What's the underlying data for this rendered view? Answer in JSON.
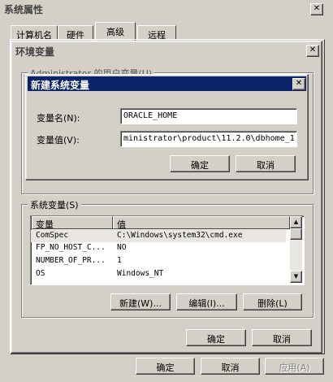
{
  "sysprops": {
    "title": "系统属性",
    "close": "✕",
    "tabs": [
      "计算机名",
      "硬件",
      "高级",
      "远程"
    ],
    "ok": "确定",
    "cancel": "取消",
    "apply": "应用(A)"
  },
  "envvars": {
    "title": "环境变量",
    "close": "✕",
    "user_group_obscured": "Administrator 的用户变量(U)",
    "sys_group": "系统变量(S)",
    "columns": [
      "变量",
      "值"
    ],
    "rows": [
      {
        "name": "ComSpec",
        "value": "C:\\Windows\\system32\\cmd.exe"
      },
      {
        "name": "FP_NO_HOST_C...",
        "value": "NO"
      },
      {
        "name": "NUMBER_OF_PR...",
        "value": "1"
      },
      {
        "name": "OS",
        "value": "Windows_NT"
      }
    ],
    "new_btn": "新建(W)...",
    "edit_btn": "编辑(I)...",
    "delete_btn": "删除(L)",
    "ok": "确定",
    "cancel": "取消"
  },
  "newvar": {
    "title": "新建系统变量",
    "close": "✕",
    "name_label": "变量名(N):",
    "value_label": "变量值(V):",
    "name_value": "ORACLE_HOME",
    "value_value": "ministrator\\product\\11.2.0\\dbhome_1",
    "ok": "确定",
    "cancel": "取消"
  },
  "colors": {
    "face": "#d4d0c8",
    "active_title": "#0a246a",
    "inactive_title_text": "#444444"
  }
}
